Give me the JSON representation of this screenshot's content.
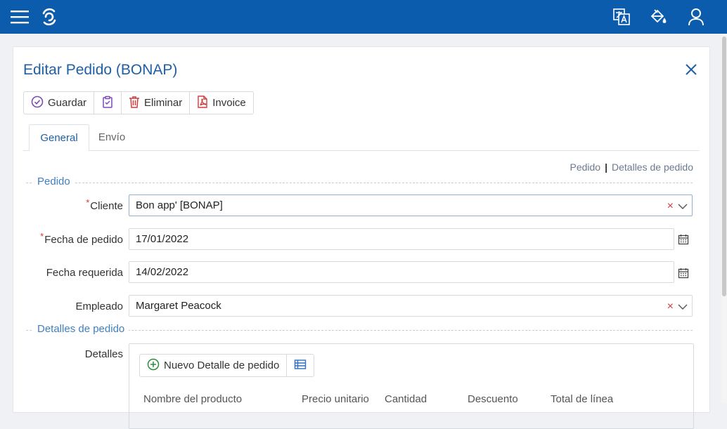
{
  "form": {
    "title": "Editar Pedido (BONAP)",
    "toolbar": {
      "save_label": "Guardar",
      "delete_label": "Eliminar",
      "invoice_label": "Invoice"
    },
    "tabs": [
      {
        "label": "General"
      },
      {
        "label": "Envío"
      }
    ],
    "quick_links": {
      "order": "Pedido",
      "separator": "|",
      "details": "Detalles de pedido"
    },
    "sections": {
      "order": "Pedido",
      "details": "Detalles de pedido"
    },
    "fields": {
      "customer": {
        "label": "Cliente",
        "value": "Bon app' [BONAP]",
        "required": true
      },
      "order_date": {
        "label": "Fecha de pedido",
        "value": "17/01/2022",
        "required": true
      },
      "required_date": {
        "label": "Fecha requerida",
        "value": "14/02/2022"
      },
      "employee": {
        "label": "Empleado",
        "value": "Margaret Peacock"
      }
    },
    "details": {
      "label": "Detalles",
      "new_button": "Nuevo Detalle de pedido",
      "columns": [
        "Nombre del producto",
        "Precio unitario",
        "Cantidad",
        "Descuento",
        "Total de línea"
      ]
    },
    "required_mark": "*",
    "clear_mark": "×"
  },
  "icons": {
    "menu": "hamburger-icon",
    "logo": "swirl-logo-icon",
    "translate": "translate-icon",
    "theme": "paint-bucket-icon",
    "user": "user-icon",
    "close": "close-icon",
    "save": "check-circle-icon",
    "clipboard": "clipboard-check-icon",
    "delete": "trash-icon",
    "invoice": "pdf-icon",
    "calendar": "calendar-icon",
    "add": "plus-circle-icon",
    "columns": "column-list-icon"
  },
  "colors": {
    "topbar": "#0b5cad",
    "accent": "#1f5fa6",
    "danger": "#d33c3c",
    "required": "#dd3333"
  }
}
